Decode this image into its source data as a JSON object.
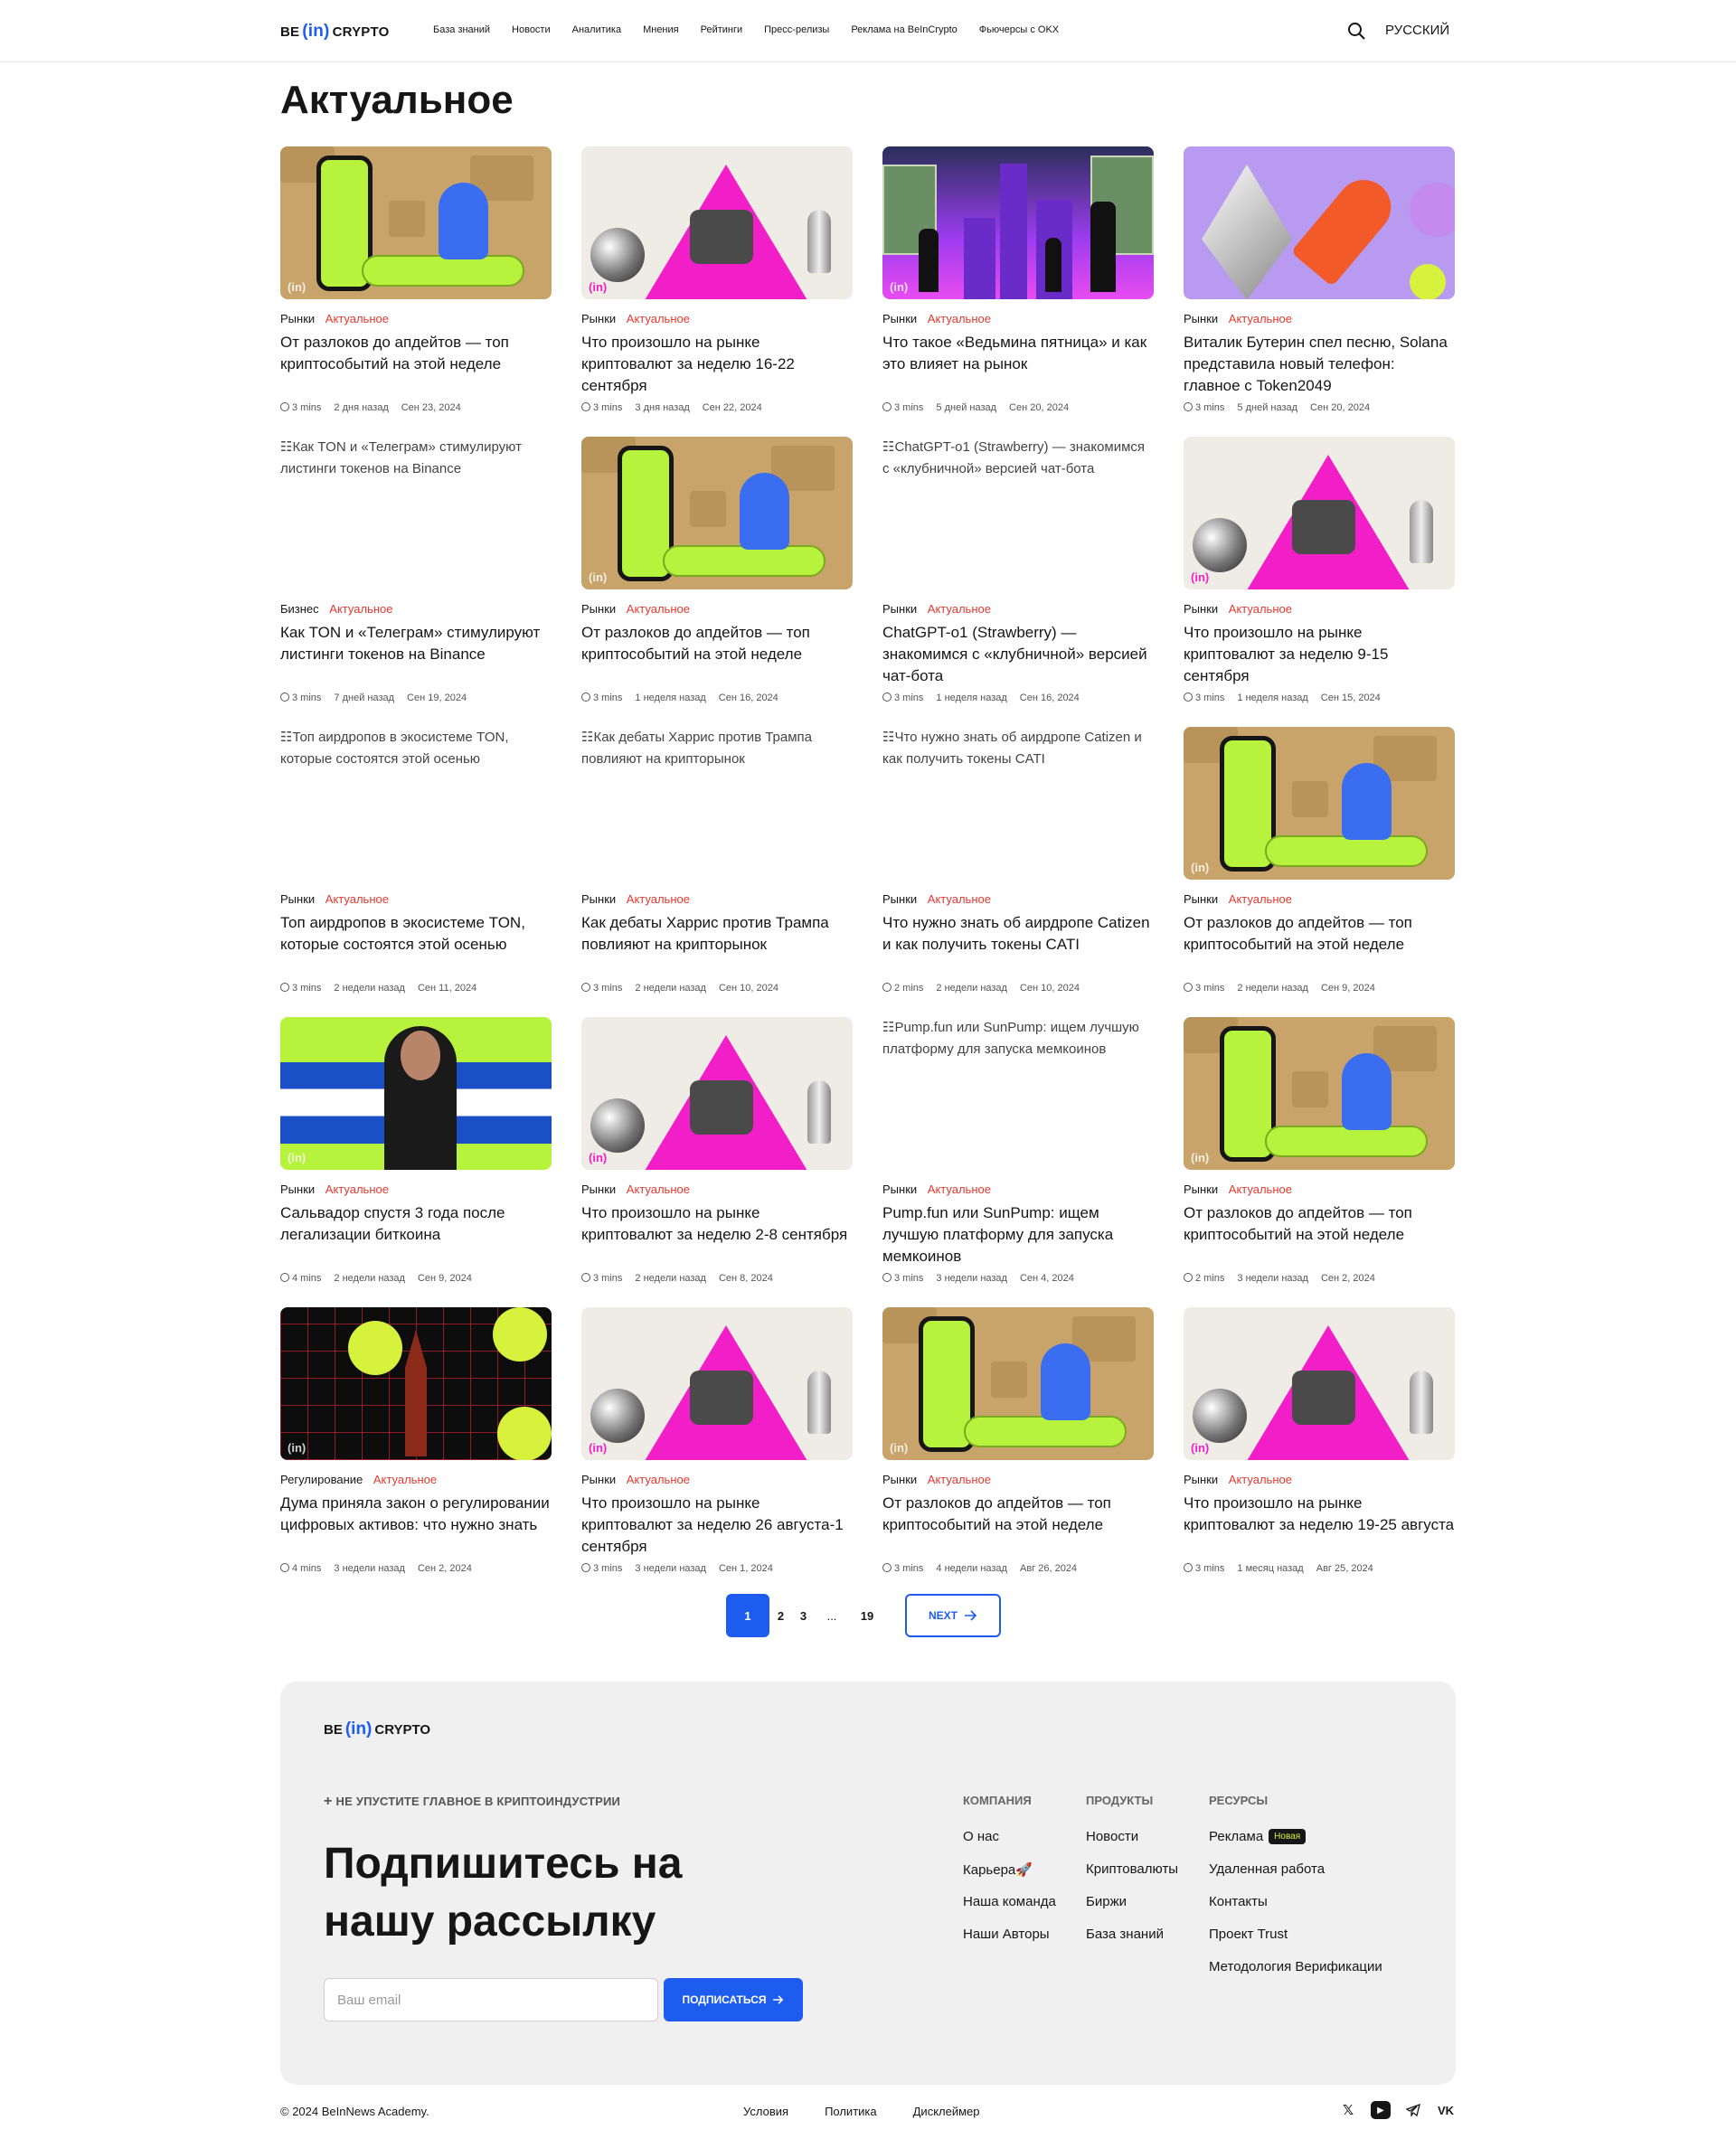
{
  "header": {
    "logo": {
      "left": "BE",
      "mid": "(in)",
      "right": "CRYPTO"
    },
    "nav": [
      "База знаний",
      "Новости",
      "Аналитика",
      "Мнения",
      "Рейтинги",
      "Пресс-релизы",
      "Реклама на BeInCrypto",
      "Фьючерсы с OKX"
    ],
    "language": "РУССКИЙ"
  },
  "page_title": "Актуальное",
  "cards": [
    {
      "art": "thinker",
      "cat": "Рынки",
      "topic": "Актуальное",
      "title": "От разлоков до апдейтов — топ криптособытий на этой неделе",
      "read": "3 mins",
      "ago": "2 дня назад",
      "date": "Сен 23, 2024"
    },
    {
      "art": "beach",
      "cat": "Рынки",
      "topic": "Актуальное",
      "title": "Что произошло на рынке криптовалют за неделю 16-22 сентября",
      "read": "3 mins",
      "ago": "3 дня назад",
      "date": "Сен 22, 2024"
    },
    {
      "art": "friday",
      "cat": "Рынки",
      "topic": "Актуальное",
      "title": "Что такое «Ведьмина пятница» и как это влияет на рынок",
      "read": "3 mins",
      "ago": "5 дней назад",
      "date": "Сен 20, 2024"
    },
    {
      "art": "rocket",
      "cat": "Рынки",
      "topic": "Актуальное",
      "title": "Виталик Бутерин спел песню, Solana представила новый телефон: главное с Token2049",
      "read": "3 mins",
      "ago": "5 дней назад",
      "date": "Сен 20, 2024"
    },
    {
      "art": "broken",
      "alt": "Как TON и «Телеграм» стимулируют листинги токенов на Binance",
      "cat": "Бизнес",
      "topic": "Актуальное",
      "title": "Как TON и «Телеграм» стимулируют листинги токенов на Binance",
      "read": "3 mins",
      "ago": "7 дней назад",
      "date": "Сен 19, 2024"
    },
    {
      "art": "thinker",
      "cat": "Рынки",
      "topic": "Актуальное",
      "title": "От разлоков до апдейтов — топ криптособытий на этой неделе",
      "read": "3 mins",
      "ago": "1 неделя назад",
      "date": "Сен 16, 2024"
    },
    {
      "art": "broken",
      "alt": "ChatGPT-o1 (Strawberry) — знакомимся с «клубничной» версией чат-бота",
      "cat": "Рынки",
      "topic": "Актуальное",
      "title": "ChatGPT-o1 (Strawberry) — знакомимся с «клубничной» версией чат-бота",
      "read": "3 mins",
      "ago": "1 неделя назад",
      "date": "Сен 16, 2024"
    },
    {
      "art": "beach",
      "cat": "Рынки",
      "topic": "Актуальное",
      "title": "Что произошло на рынке криптовалют за неделю 9-15 сентября",
      "read": "3 mins",
      "ago": "1 неделя назад",
      "date": "Сен 15, 2024"
    },
    {
      "art": "broken",
      "alt": "Топ аирдропов в экосистеме TON, которые состоятся этой осенью",
      "cat": "Рынки",
      "topic": "Актуальное",
      "title": "Топ аирдропов в экосистеме TON, которые состоятся этой осенью",
      "read": "3 mins",
      "ago": "2 недели назад",
      "date": "Сен 11, 2024"
    },
    {
      "art": "broken",
      "alt": "Как дебаты Харрис против Трампа повлияют на крипторынок",
      "cat": "Рынки",
      "topic": "Актуальное",
      "title": "Как дебаты Харрис против Трампа повлияют на крипторынок",
      "read": "3 mins",
      "ago": "2 недели назад",
      "date": "Сен 10, 2024"
    },
    {
      "art": "broken",
      "alt": "Что нужно знать об аирдропе Catizen и как получить токены CATI",
      "cat": "Рынки",
      "topic": "Актуальное",
      "title": "Что нужно знать об аирдропе Catizen и как получить токены CATI",
      "read": "2 mins",
      "ago": "2 недели назад",
      "date": "Сен 10, 2024"
    },
    {
      "art": "thinker",
      "cat": "Рынки",
      "topic": "Актуальное",
      "title": "От разлоков до апдейтов — топ криптособытий на этой неделе",
      "read": "3 mins",
      "ago": "2 недели назад",
      "date": "Сен 9, 2024"
    },
    {
      "art": "salvador",
      "cat": "Рынки",
      "topic": "Актуальное",
      "title": "Сальвадор спустя 3 года после легализации биткоина",
      "read": "4 mins",
      "ago": "2 недели назад",
      "date": "Сен 9, 2024"
    },
    {
      "art": "beach",
      "cat": "Рынки",
      "topic": "Актуальное",
      "title": "Что произошло на рынке криптовалют за неделю 2-8 сентября",
      "read": "3 mins",
      "ago": "2 недели назад",
      "date": "Сен 8, 2024"
    },
    {
      "art": "broken",
      "alt": "Pump.fun или SunPump: ищем лучшую платформу для запуска мемкоинов",
      "cat": "Рынки",
      "topic": "Актуальное",
      "title": "Pump.fun или SunPump: ищем лучшую платформу для запуска мемкоинов",
      "read": "3 mins",
      "ago": "3 недели назад",
      "date": "Сен 4, 2024"
    },
    {
      "art": "thinker",
      "cat": "Рынки",
      "topic": "Актуальное",
      "title": "От разлоков до апдейтов — топ криптособытий на этой неделе",
      "read": "2 mins",
      "ago": "3 недели назад",
      "date": "Сен 2, 2024"
    },
    {
      "art": "kremlin",
      "cat": "Регулирование",
      "topic": "Актуальное",
      "title": "Дума приняла закон о регулировании цифровых активов: что нужно знать",
      "read": "4 mins",
      "ago": "3 недели назад",
      "date": "Сен 2, 2024"
    },
    {
      "art": "beach",
      "cat": "Рынки",
      "topic": "Актуальное",
      "title": "Что произошло на рынке криптовалют за неделю 26 августа-1 сентября",
      "read": "3 mins",
      "ago": "3 недели назад",
      "date": "Сен 1, 2024"
    },
    {
      "art": "thinker",
      "cat": "Рынки",
      "topic": "Актуальное",
      "title": "От разлоков до апдейтов — топ криптособытий на этой неделе",
      "read": "3 mins",
      "ago": "4 недели назад",
      "date": "Авг 26, 2024"
    },
    {
      "art": "beach",
      "cat": "Рынки",
      "topic": "Актуальное",
      "title": "Что произошло на рынке криптовалют за неделю 19-25 августа",
      "read": "3 mins",
      "ago": "1 месяц назад",
      "date": "Авг 25, 2024"
    }
  ],
  "pagination": {
    "pages": [
      "1",
      "2",
      "3"
    ],
    "dots": "...",
    "last": "19",
    "next": "NEXT",
    "current": "1"
  },
  "footer": {
    "logo": {
      "left": "BE",
      "mid": "(in)",
      "right": "CRYPTO"
    },
    "eyebrow": "НЕ УПУСТИТЕ ГЛАВНОЕ В КРИПТОИНДУСТРИИ",
    "title": "Подпишитесь на нашу рассылку",
    "email_placeholder": "Ваш email",
    "subscribe": "ПОДПИСАТЬСЯ",
    "columns": [
      {
        "heading": "КОМПАНИЯ",
        "links": [
          "О нас",
          "Карьера🚀",
          "Наша команда",
          "Наши Авторы"
        ]
      },
      {
        "heading": "ПРОДУКТЫ",
        "links": [
          "Новости",
          "Криптовалюты",
          "Биржи",
          "База знаний"
        ]
      },
      {
        "heading": "РЕСУРСЫ",
        "links": [
          "Реклама",
          "Удаленная работа",
          "Контакты",
          "Проект Trust",
          "Методология  Верификации"
        ]
      }
    ],
    "new_badge": "Новая",
    "copyright": "© 2024 BeInNews Academy.",
    "bottom_links": [
      "Условия",
      "Политика",
      "Дисклеймер"
    ],
    "socials": [
      "x-icon",
      "youtube-icon",
      "telegram-icon",
      "vk-icon"
    ]
  },
  "colors": {
    "accent": "#1e5cf0",
    "topic": "#e5392f",
    "lime": "#b7f23c"
  }
}
